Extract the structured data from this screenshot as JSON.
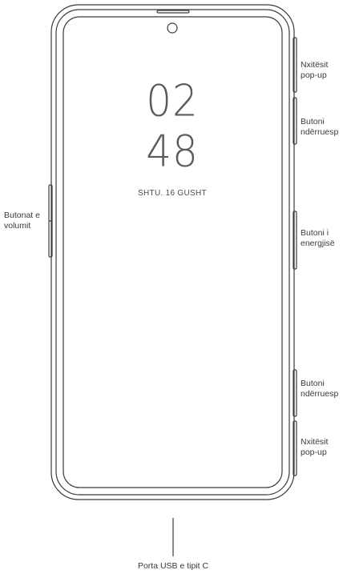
{
  "screen": {
    "hours": "02",
    "minutes": "48",
    "date": "SHTU. 16 GUSHT"
  },
  "labels": {
    "popup_top": [
      "Nxitësit",
      "pop-up"
    ],
    "switch_top": [
      "Butoni",
      "ndërruesp"
    ],
    "power": [
      "Butoni i",
      "energjisë"
    ],
    "switch_bottom": [
      "Butoni",
      "ndërruesp"
    ],
    "popup_bottom": [
      "Nxitësit",
      "pop-up"
    ],
    "volume": [
      "Butonat e",
      "volumit"
    ],
    "usb": "Porta USB e tipit C"
  },
  "colors": {
    "outline": "#3a3a3a",
    "text": "#3a3a3a"
  }
}
